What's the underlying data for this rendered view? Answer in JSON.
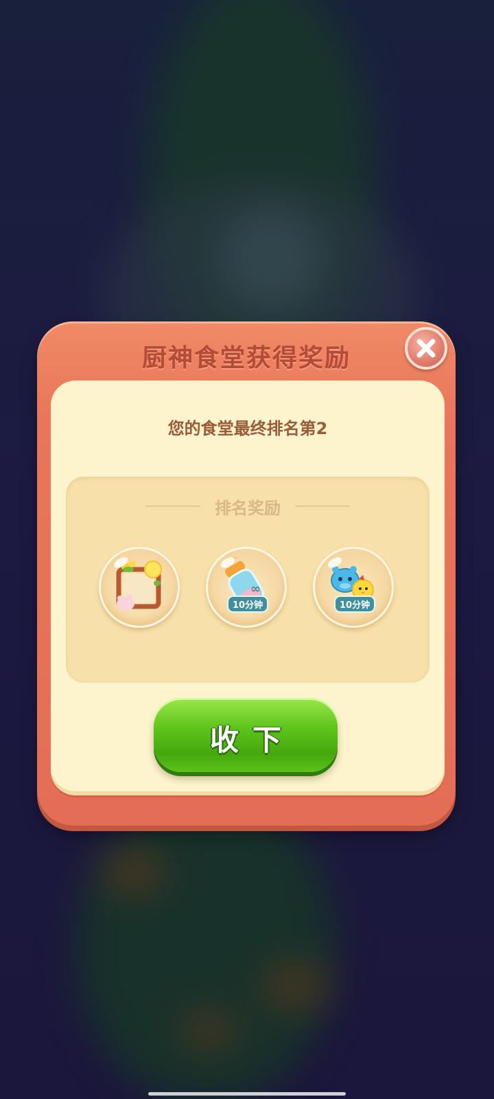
{
  "dialog": {
    "title": "厨神食堂获得奖励",
    "rank_text": "您的食堂最终排名第2",
    "section_title": "排名奖励",
    "rewards": [
      {
        "icon": "photo-frame-icon",
        "tag": ""
      },
      {
        "icon": "infinite-bottle-icon",
        "tag": "10分钟"
      },
      {
        "icon": "hippo-chick-booster-icon",
        "tag": "10分钟"
      }
    ],
    "confirm_label": "收下"
  },
  "colors": {
    "dialog_frame": "#e9755a",
    "dialog_inner": "#fdf3cc",
    "button_green": "#5fc41c",
    "title_text": "#b44b36"
  }
}
